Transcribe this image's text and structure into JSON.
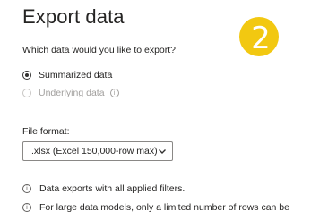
{
  "dialog": {
    "title": "Export data",
    "step_number": "2",
    "step_badge_color": "#f2c811",
    "question": "Which data would you like to export?",
    "options": [
      {
        "label": "Summarized data",
        "selected": true,
        "disabled": false
      },
      {
        "label": "Underlying data",
        "selected": false,
        "disabled": true,
        "has_info_icon": true
      }
    ],
    "file_format": {
      "label": "File format:",
      "selected": ".xlsx (Excel 150,000-row max)"
    },
    "notes": [
      "Data exports with all applied filters.",
      "For large data models, only a limited number of rows can be"
    ]
  }
}
